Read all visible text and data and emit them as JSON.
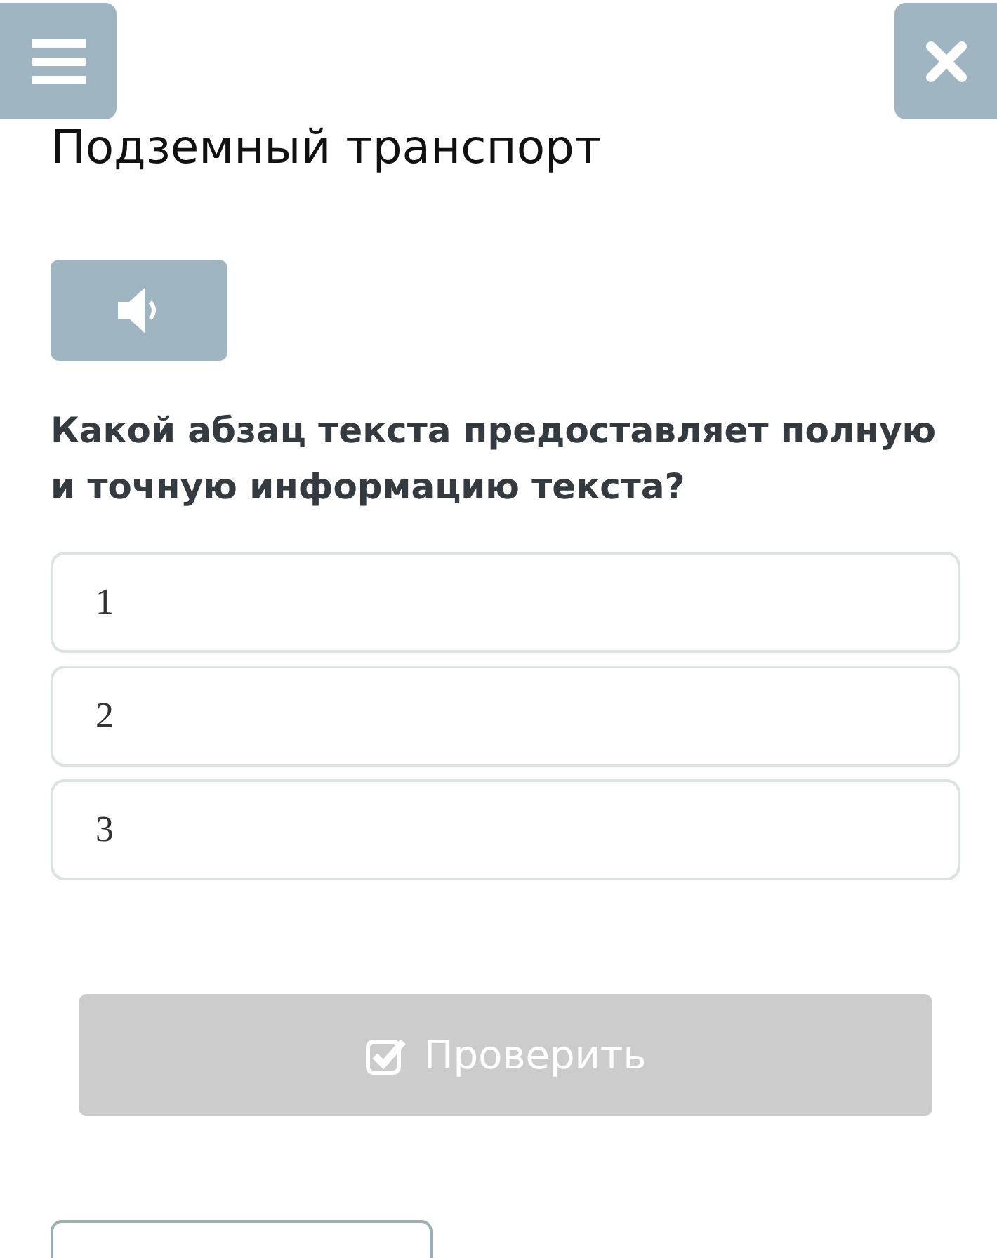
{
  "title": "Подземный транспорт",
  "question": "Какой абзац текста предоставляет полную и точную информацию текста?",
  "options": [
    {
      "label": "1",
      "selected": false
    },
    {
      "label": "2",
      "selected": false
    },
    {
      "label": "3",
      "selected": false
    }
  ],
  "check_button": {
    "label": "Проверить",
    "disabled": true
  }
}
